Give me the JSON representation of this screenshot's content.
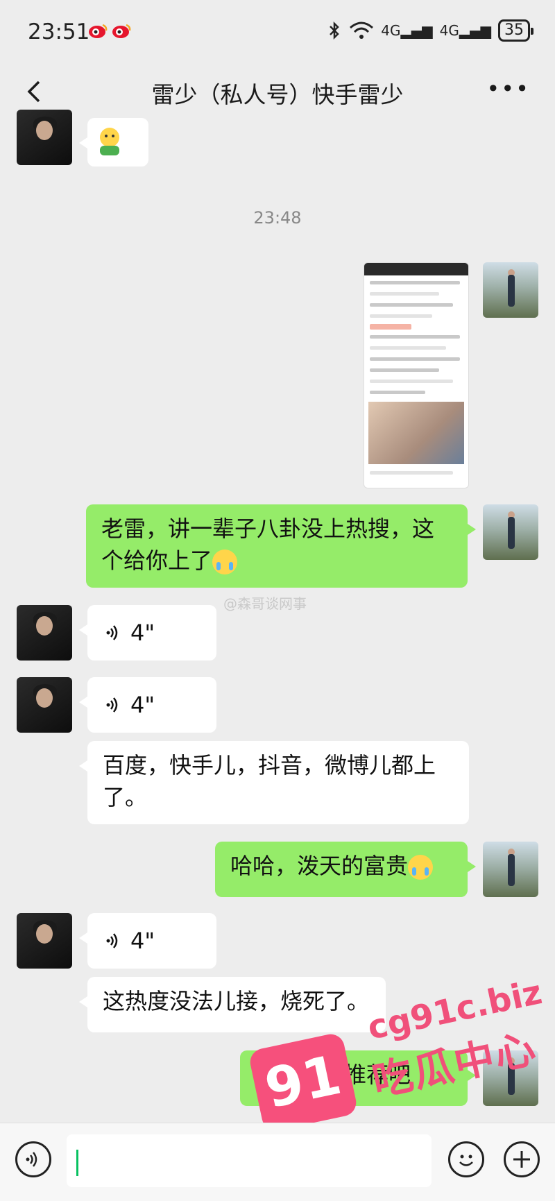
{
  "status": {
    "time": "23:51",
    "network_1": "4G",
    "network_2": "4G",
    "battery": "35"
  },
  "header": {
    "title": "雷少（私人号）快手雷少"
  },
  "chat": {
    "timestamp": "23:48",
    "msg_out_1": "老雷，讲一辈子八卦没上热搜，这个给你上了",
    "voice_1": "4\"",
    "voice_2": "4\"",
    "msg_in_1": "百度，快手儿，抖音，微博儿都上了。",
    "msg_out_2": "哈哈，泼天的富贵",
    "voice_3": "4\"",
    "msg_in_2": "这热度没法儿接，烧死了。",
    "msg_out_3": "别说了，推荐吧"
  },
  "watermarks": {
    "weibo_handle": "@森哥谈网事",
    "site": "cg91c.biz",
    "site_cn": "吃瓜中心",
    "badge_number": "91"
  },
  "icons": {
    "back": "chevron-left-icon",
    "more": "more-dots-icon",
    "voice": "voice-icon",
    "emoji": "emoji-icon",
    "add": "plus-icon"
  }
}
